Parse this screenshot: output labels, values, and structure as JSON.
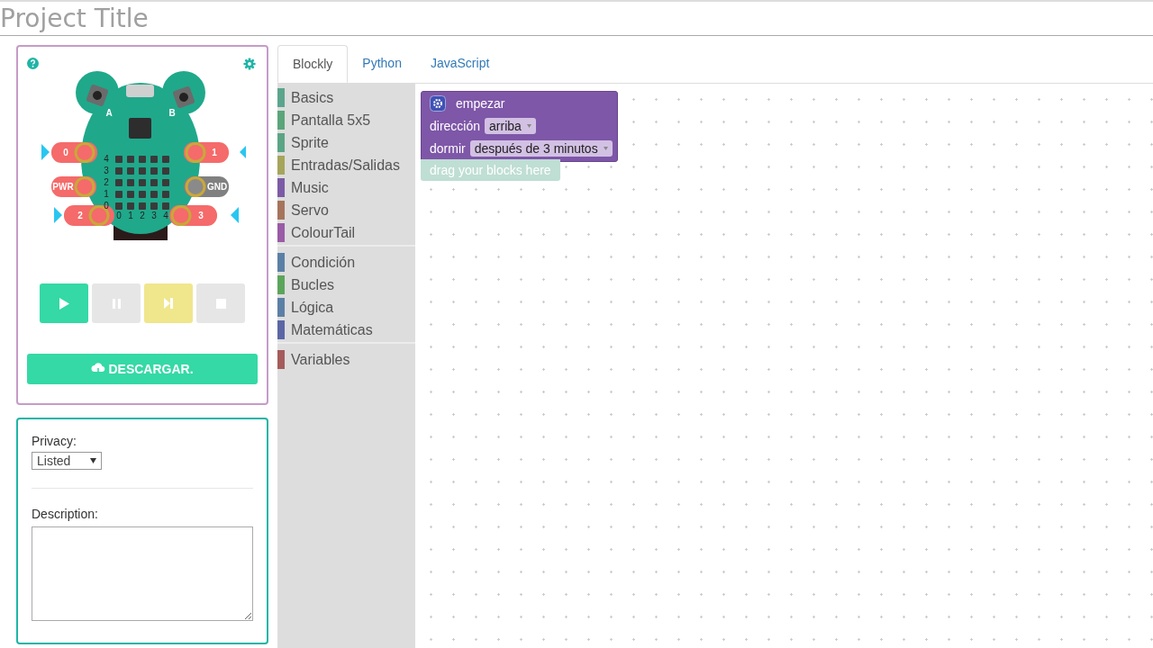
{
  "project_title": {
    "placeholder": "Project Title"
  },
  "simulator": {
    "button_labels": [
      "A",
      "B"
    ],
    "pins": [
      {
        "label": "0",
        "kind": "io"
      },
      {
        "label": "1",
        "kind": "io"
      },
      {
        "label": "PWR",
        "kind": "power"
      },
      {
        "label": "GND",
        "kind": "ground"
      },
      {
        "label": "2",
        "kind": "io"
      },
      {
        "label": "3",
        "kind": "io"
      }
    ],
    "row_labels": [
      "4",
      "3",
      "2",
      "1",
      "0"
    ],
    "column_labels": [
      "0",
      "1",
      "2",
      "3",
      "4"
    ],
    "controls": [
      {
        "kind": "play",
        "disabled": false
      },
      {
        "kind": "pause",
        "disabled": true
      },
      {
        "kind": "step",
        "disabled": false
      },
      {
        "kind": "stop",
        "disabled": true
      }
    ],
    "download_label": "DESCARGAR."
  },
  "settings": {
    "privacy_label": "Privacy:",
    "privacy_value": "Listed",
    "description_label": "Description:"
  },
  "tabs": [
    {
      "label": "Blockly",
      "selected": true
    },
    {
      "label": "Python",
      "selected": false
    },
    {
      "label": "JavaScript",
      "selected": false
    }
  ],
  "toolbox": {
    "groups": [
      [
        {
          "label": "Basics",
          "color": "#5ba58c"
        },
        {
          "label": "Pantalla 5x5",
          "color": "#5ba57a"
        },
        {
          "label": "Sprite",
          "color": "#5ba584"
        },
        {
          "label": "Entradas/Salidas",
          "color": "#a5a55b"
        },
        {
          "label": "Music",
          "color": "#7c5ba5"
        },
        {
          "label": "Servo",
          "color": "#a5745b"
        },
        {
          "label": "ColourTail",
          "color": "#9a5ba5"
        }
      ],
      [
        {
          "label": "Condición",
          "color": "#5b80a5"
        },
        {
          "label": "Bucles",
          "color": "#5ba55b"
        },
        {
          "label": "Lógica",
          "color": "#5b80a5"
        },
        {
          "label": "Matemáticas",
          "color": "#5b67a5"
        }
      ],
      [
        {
          "label": "Variables",
          "color": "#a55b5b"
        }
      ]
    ]
  },
  "workspace": {
    "block": {
      "title": "empezar",
      "fields": [
        {
          "label": "dirección",
          "value": "arriba"
        },
        {
          "label": "dormir",
          "value": "después de 3 minutos"
        }
      ]
    },
    "hint": "drag your blocks here"
  }
}
